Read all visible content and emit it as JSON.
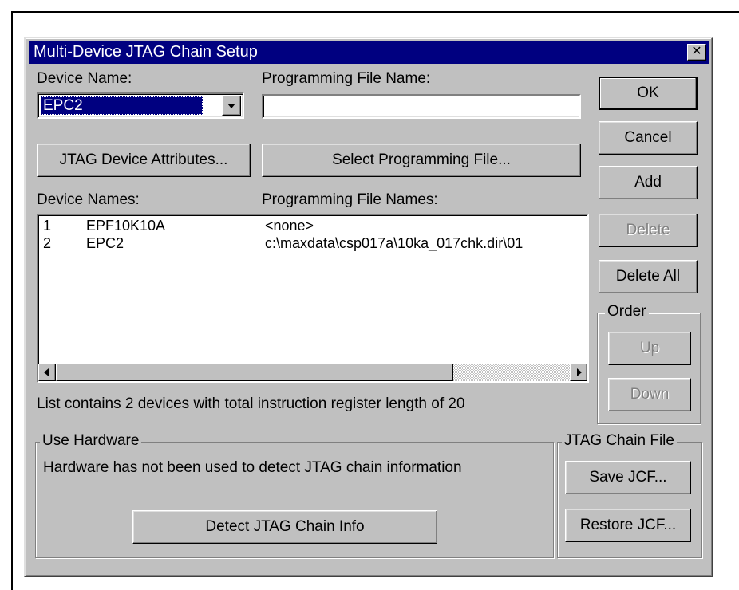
{
  "dialog": {
    "title": "Multi-Device JTAG Chain Setup",
    "close_glyph": "✕"
  },
  "fields": {
    "device_name_label": "Device Name:",
    "device_name_value": "EPC2",
    "programming_file_label": "Programming File Name:",
    "programming_file_value": ""
  },
  "buttons": {
    "jtag_attributes": "JTAG Device Attributes...",
    "select_file": "Select Programming File...",
    "ok": "OK",
    "cancel": "Cancel",
    "add": "Add",
    "delete": "Delete",
    "delete_all": "Delete All",
    "up": "Up",
    "down": "Down",
    "save_jcf": "Save JCF...",
    "restore_jcf": "Restore JCF...",
    "detect": "Detect JTAG Chain Info"
  },
  "list": {
    "col_device_label": "Device Names:",
    "col_file_label": "Programming File Names:",
    "rows": [
      {
        "index": "1",
        "device": "EPF10K10A",
        "file": "<none>"
      },
      {
        "index": "2",
        "device": "EPC2",
        "file": "c:\\maxdata\\csp017a\\10ka_017chk.dir\\01"
      }
    ],
    "summary": "List contains 2 devices with total instruction register length of 20"
  },
  "groups": {
    "order": "Order",
    "use_hardware": "Use Hardware",
    "hardware_status": "Hardware has not been used to detect JTAG chain information",
    "jtag_chain_file": "JTAG Chain File"
  }
}
